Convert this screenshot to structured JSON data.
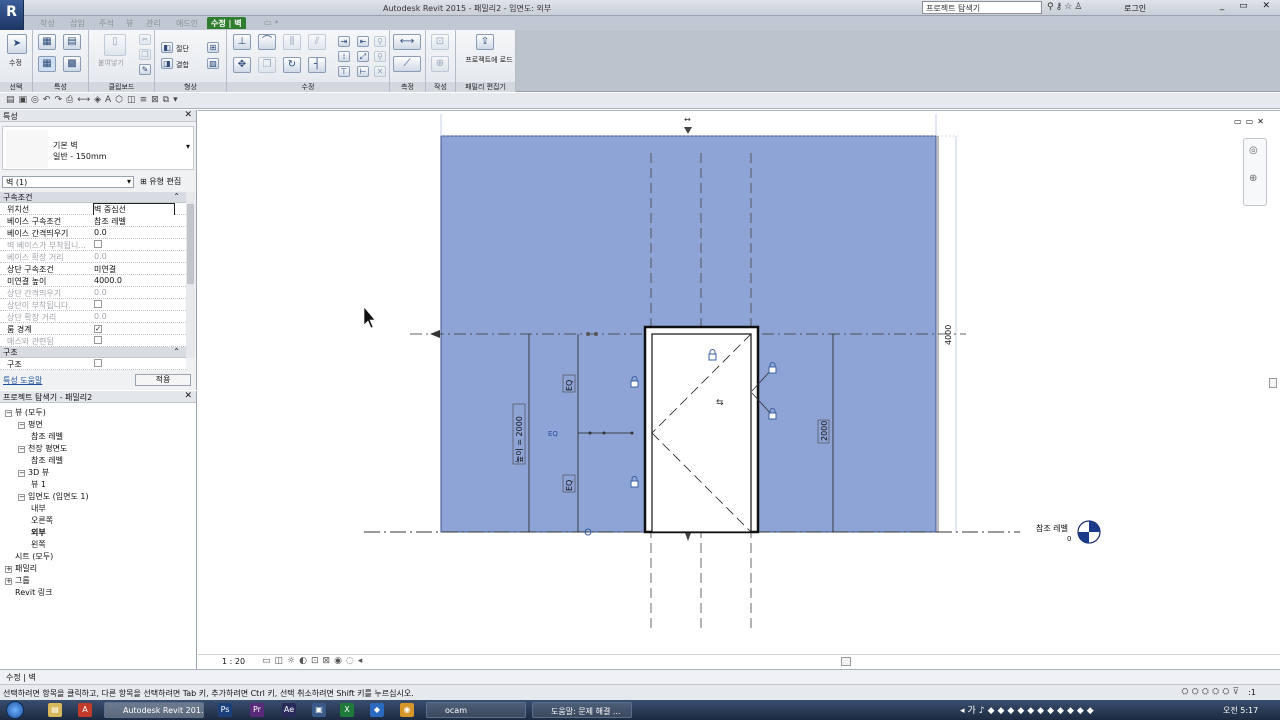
{
  "window": {
    "title": "Autodesk Revit 2015 -     패밀리2 - 입면도: 외부",
    "app_button": "R",
    "help_search_placeholder": "프로젝트 탐색기",
    "login": "로그인",
    "controls": "_ ▭ ✕"
  },
  "ribbon": {
    "tabs": [
      {
        "label": "작성",
        "active": false
      },
      {
        "label": "삽입",
        "active": false
      },
      {
        "label": "주석",
        "active": false
      },
      {
        "label": "뷰",
        "active": false
      },
      {
        "label": "관리",
        "active": false
      },
      {
        "label": "애드인",
        "active": false
      },
      {
        "label": "수정 | 벽",
        "active": true
      },
      {
        "label": "▭ •",
        "active": false
      }
    ],
    "groups": {
      "select": "선택",
      "properties": "특성",
      "clipboard": "클립보드",
      "geometry": "형상",
      "modify": "수정",
      "measure": "측정",
      "create": "작성",
      "family_editor": "패밀리 편집기"
    },
    "modify_button": "수정",
    "paste_label": "붙여넣기",
    "cut_label": "절단",
    "join_label": "결합",
    "load_into_project": "프로젝트에 로드"
  },
  "properties": {
    "title": "특성",
    "type_name": "기본 벽",
    "type_sub": "일반 - 150mm",
    "instance_filter": "벽 (1)",
    "edit_type": "유형 편집",
    "sections": [
      {
        "name": "구속조건",
        "rows": [
          {
            "name": "위치선",
            "value": "벽 중심선",
            "disabled": false,
            "check": null,
            "selected": true
          },
          {
            "name": "베이스 구속조건",
            "value": "참조 레벨",
            "disabled": false,
            "check": null,
            "selected": false
          },
          {
            "name": "베이스 간격띄우기",
            "value": "0.0",
            "disabled": false,
            "check": null,
            "selected": false
          },
          {
            "name": "벽 베이스가 부착됩니...",
            "value": "",
            "disabled": true,
            "check": false,
            "selected": false
          },
          {
            "name": "베이스 확장 거리",
            "value": "0.0",
            "disabled": true,
            "check": null,
            "selected": false
          },
          {
            "name": "상단 구속조건",
            "value": "미연결",
            "disabled": false,
            "check": null,
            "selected": false
          },
          {
            "name": "미연결 높이",
            "value": "4000.0",
            "disabled": false,
            "check": null,
            "selected": false
          },
          {
            "name": "상단 간격띄우기",
            "value": "0.0",
            "disabled": true,
            "check": null,
            "selected": false
          },
          {
            "name": "상단이 부착됩니다.",
            "value": "",
            "disabled": true,
            "check": false,
            "selected": false
          },
          {
            "name": "상단 확장 거리",
            "value": "0.0",
            "disabled": true,
            "check": null,
            "selected": false
          },
          {
            "name": "룸 경계",
            "value": "",
            "disabled": false,
            "check": true,
            "selected": false
          },
          {
            "name": "매스와 관련됨",
            "value": "",
            "disabled": true,
            "check": false,
            "selected": false
          }
        ]
      },
      {
        "name": "구조",
        "rows": [
          {
            "name": "구조",
            "value": "",
            "disabled": false,
            "check": false,
            "selected": false
          }
        ]
      }
    ],
    "help_link": "특성 도움말",
    "apply": "적용"
  },
  "browser": {
    "title": "프로젝트 탐색기 - 패밀리2",
    "nodes": [
      {
        "label": "뷰 (모두)",
        "level": 0,
        "toggle": "−",
        "bold": false
      },
      {
        "label": "평면",
        "level": 1,
        "toggle": "−",
        "bold": false
      },
      {
        "label": "참조 레벨",
        "level": 2,
        "toggle": "",
        "bold": false
      },
      {
        "label": "천장 평면도",
        "level": 1,
        "toggle": "−",
        "bold": false
      },
      {
        "label": "참조 레벨",
        "level": 2,
        "toggle": "",
        "bold": false
      },
      {
        "label": "3D 뷰",
        "level": 1,
        "toggle": "−",
        "bold": false
      },
      {
        "label": "뷰 1",
        "level": 2,
        "toggle": "",
        "bold": false
      },
      {
        "label": "입면도 (입면도 1)",
        "level": 1,
        "toggle": "−",
        "bold": false
      },
      {
        "label": "내부",
        "level": 2,
        "toggle": "",
        "bold": false
      },
      {
        "label": "오른쪽",
        "level": 2,
        "toggle": "",
        "bold": false
      },
      {
        "label": "외부",
        "level": 2,
        "toggle": "",
        "bold": true
      },
      {
        "label": "왼쪽",
        "level": 2,
        "toggle": "",
        "bold": false
      },
      {
        "label": "시트 (모두)",
        "level": 0,
        "toggle": "",
        "bold": false
      },
      {
        "label": "패밀리",
        "level": 0,
        "toggle": "+",
        "bold": false
      },
      {
        "label": "그룹",
        "level": 0,
        "toggle": "+",
        "bold": false
      },
      {
        "label": "Revit 링크",
        "level": 0,
        "toggle": "",
        "bold": false
      }
    ]
  },
  "drawing": {
    "wall_color": "#8ea4d6",
    "height_dim": "4000",
    "door_dim_left": "높이 = 2000",
    "door_dim_right": "2000",
    "eq_labels": [
      "EQ",
      "EQ",
      "EQ"
    ],
    "level_name": "참조 레벨",
    "level_value": "0"
  },
  "view_bar": {
    "scale": "1 : 20"
  },
  "context_bar": "수정 | 벽",
  "status": {
    "message": "선택하려면 항목을 클릭하고, 다른 항목을 선택하려면 Tab 키, 추가하려면 Ctrl 키, 선택 취소하려면 Shift 키를 누르십시오.",
    "filter_count": ":1"
  },
  "taskbar": {
    "tasks": [
      "Autodesk Revit 201...",
      "ocam",
      "도움말: 문제 해결 ..."
    ],
    "clock": "오전 5:17"
  }
}
